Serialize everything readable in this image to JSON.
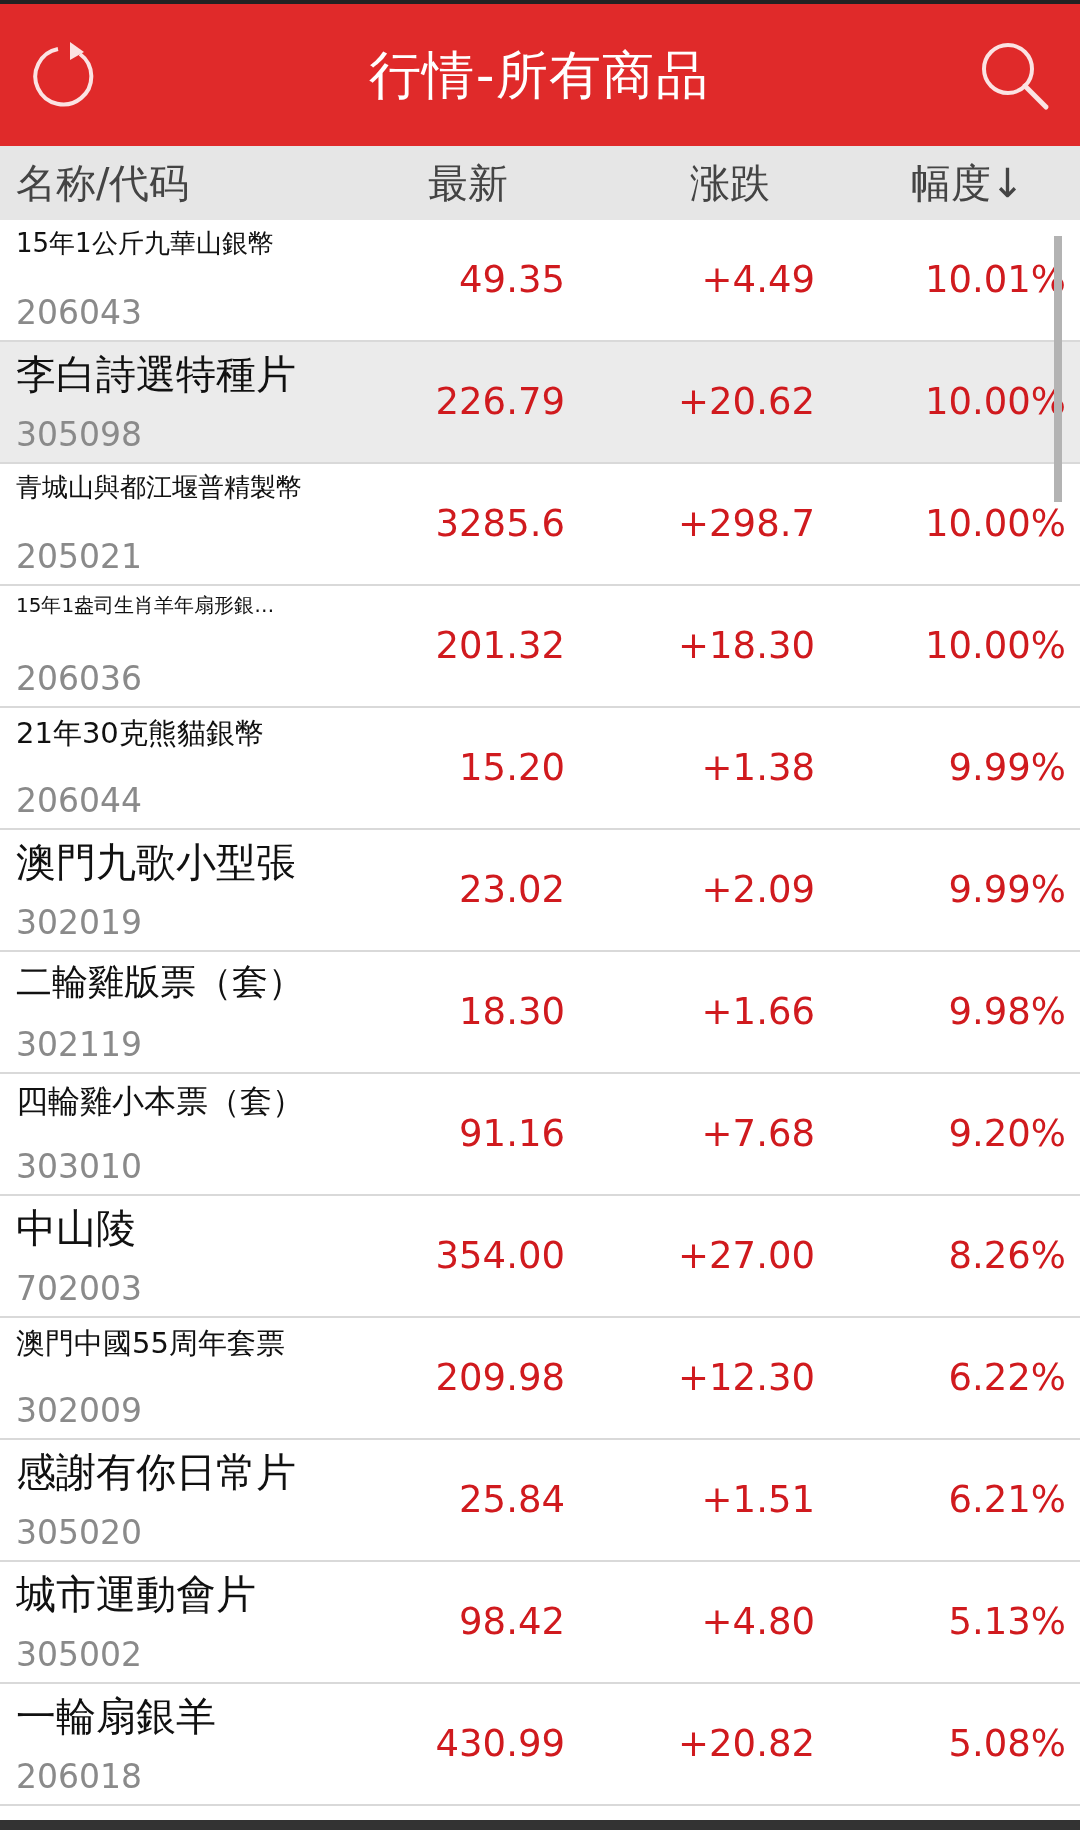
{
  "header": {
    "title": "行情-所有商品"
  },
  "columns": [
    {
      "label": "名称/代码"
    },
    {
      "label": "最新"
    },
    {
      "label": "涨跌"
    },
    {
      "label": "幅度↓"
    }
  ],
  "rows": [
    {
      "name": "15年1公斤九華山銀幣",
      "code": "206043",
      "price": "49.35",
      "change": "+4.49",
      "percent": "10.01%",
      "selected": false
    },
    {
      "name": "李白詩選特種片",
      "code": "305098",
      "price": "226.79",
      "change": "+20.62",
      "percent": "10.00%",
      "selected": true
    },
    {
      "name": "青城山與都江堰普精製幣",
      "code": "205021",
      "price": "3285.6",
      "change": "+298.7",
      "percent": "10.00%",
      "selected": false
    },
    {
      "name": "15年1盎司生肖羊年扇形銀…",
      "code": "206036",
      "price": "201.32",
      "change": "+18.30",
      "percent": "10.00%",
      "selected": false
    },
    {
      "name": "21年30克熊貓銀幣",
      "code": "206044",
      "price": "15.20",
      "change": "+1.38",
      "percent": "9.99%",
      "selected": false
    },
    {
      "name": "澳門九歌小型張",
      "code": "302019",
      "price": "23.02",
      "change": "+2.09",
      "percent": "9.99%",
      "selected": false
    },
    {
      "name": "二輪雞版票（套）",
      "code": "302119",
      "price": "18.30",
      "change": "+1.66",
      "percent": "9.98%",
      "selected": false
    },
    {
      "name": "四輪雞小本票（套）",
      "code": "303010",
      "price": "91.16",
      "change": "+7.68",
      "percent": "9.20%",
      "selected": false
    },
    {
      "name": "中山陵",
      "code": "702003",
      "price": "354.00",
      "change": "+27.00",
      "percent": "8.26%",
      "selected": false
    },
    {
      "name": "澳門中國55周年套票",
      "code": "302009",
      "price": "209.98",
      "change": "+12.30",
      "percent": "6.22%",
      "selected": false
    },
    {
      "name": "感謝有你日常片",
      "code": "305020",
      "price": "25.84",
      "change": "+1.51",
      "percent": "6.21%",
      "selected": false
    },
    {
      "name": "城市運動會片",
      "code": "305002",
      "price": "98.42",
      "change": "+4.80",
      "percent": "5.13%",
      "selected": false
    },
    {
      "name": "一輪扇銀羊",
      "code": "206018",
      "price": "430.99",
      "change": "+20.82",
      "percent": "5.08%",
      "selected": false
    }
  ]
}
